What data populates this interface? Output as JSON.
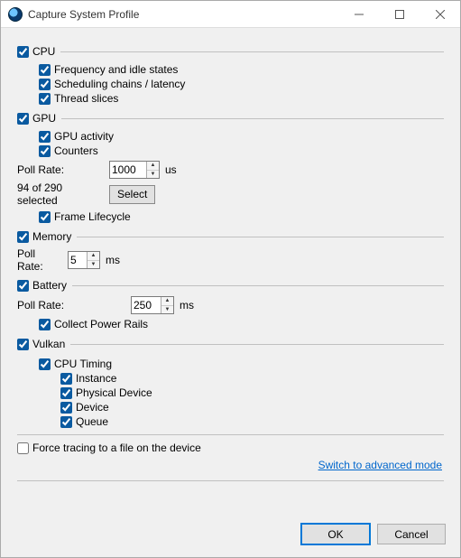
{
  "window": {
    "title": "Capture System Profile"
  },
  "cpu": {
    "label": "CPU",
    "freq": "Frequency and idle states",
    "sched": "Scheduling chains / latency",
    "slices": "Thread slices"
  },
  "gpu": {
    "label": "GPU",
    "activity": "GPU activity",
    "counters": "Counters",
    "poll_label": "Poll Rate:",
    "poll_value": "1000",
    "poll_unit": "us",
    "selected_text": "94 of 290 selected",
    "select_btn": "Select",
    "frame": "Frame Lifecycle"
  },
  "memory": {
    "label": "Memory",
    "poll_label": "Poll Rate:",
    "poll_value": "5",
    "poll_unit": "ms"
  },
  "battery": {
    "label": "Battery",
    "poll_label": "Poll Rate:",
    "poll_value": "250",
    "poll_unit": "ms",
    "rails": "Collect Power Rails"
  },
  "vulkan": {
    "label": "Vulkan",
    "cputiming": "CPU Timing",
    "instance": "Instance",
    "physical": "Physical Device",
    "device": "Device",
    "queue": "Queue"
  },
  "force_trace": "Force tracing to a file on the device",
  "advanced_link": "Switch to advanced mode",
  "buttons": {
    "ok": "OK",
    "cancel": "Cancel"
  }
}
